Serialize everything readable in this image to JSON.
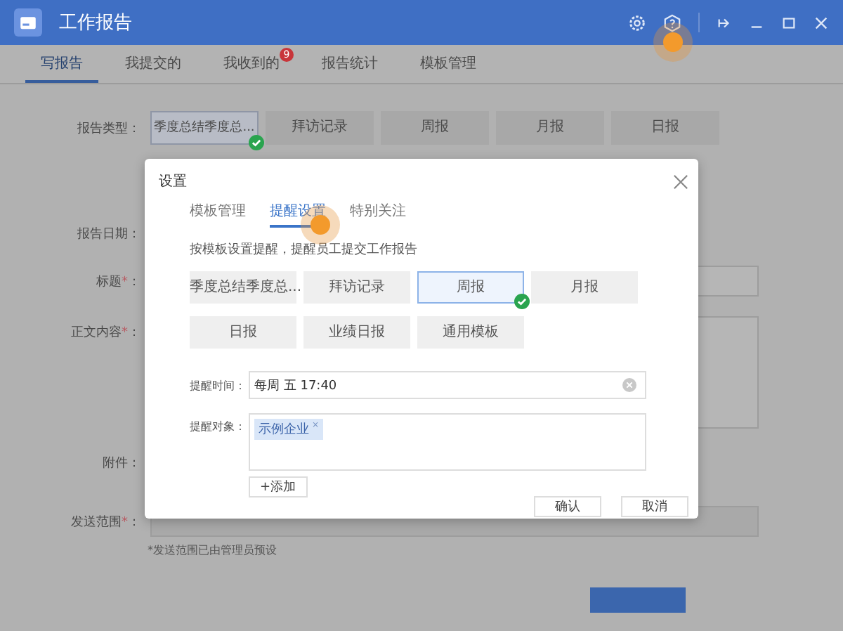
{
  "window": {
    "title": "工作报告"
  },
  "tabs": [
    {
      "label": "写报告",
      "selected": true
    },
    {
      "label": "我提交的",
      "selected": false
    },
    {
      "label": "我收到的",
      "selected": false,
      "badge": "9"
    },
    {
      "label": "报告统计",
      "selected": false
    },
    {
      "label": "模板管理",
      "selected": false
    }
  ],
  "form": {
    "fields": [
      {
        "kind": "types",
        "label": "报告类型：",
        "options": [
          {
            "label": "季度总结季度总...",
            "selected": true
          },
          {
            "label": "拜访记录",
            "selected": false
          },
          {
            "label": "周报",
            "selected": false
          },
          {
            "label": "月报",
            "selected": false
          },
          {
            "label": "日报",
            "selected": false
          }
        ]
      },
      {
        "kind": "date",
        "label": "报告日期："
      },
      {
        "kind": "text",
        "label": "标题",
        "mark": "*",
        "suffix": "："
      },
      {
        "kind": "textarea",
        "label": "正文内容",
        "mark": "*",
        "suffix": "："
      },
      {
        "kind": "attach",
        "label": "附件："
      },
      {
        "kind": "scope",
        "label": "发送范围",
        "mark": "*",
        "suffix": "："
      }
    ],
    "note": "*发送范围已由管理员预设"
  },
  "dialog": {
    "title": "设置",
    "tabs": [
      {
        "label": "模板管理",
        "selected": false
      },
      {
        "label": "提醒设置",
        "selected": true
      },
      {
        "label": "特别关注",
        "selected": false
      }
    ],
    "description": "按模板设置提醒，提醒员工提交工作报告",
    "templates": [
      {
        "label": "季度总结季度总...",
        "selected": false
      },
      {
        "label": "拜访记录",
        "selected": false
      },
      {
        "label": "周报",
        "selected": true
      },
      {
        "label": "月报",
        "selected": false
      },
      {
        "label": "日报",
        "selected": false
      },
      {
        "label": "业绩日报",
        "selected": false
      },
      {
        "label": "通用模板",
        "selected": false
      }
    ],
    "remind_time": {
      "label": "提醒时间：",
      "value": "每周 五 17:40"
    },
    "remind_target": {
      "label": "提醒对象：",
      "tags": [
        {
          "label": "示例企业",
          "remove": "×"
        }
      ]
    },
    "add_button": "+添加",
    "buttons": [
      "确认",
      "取消"
    ]
  }
}
